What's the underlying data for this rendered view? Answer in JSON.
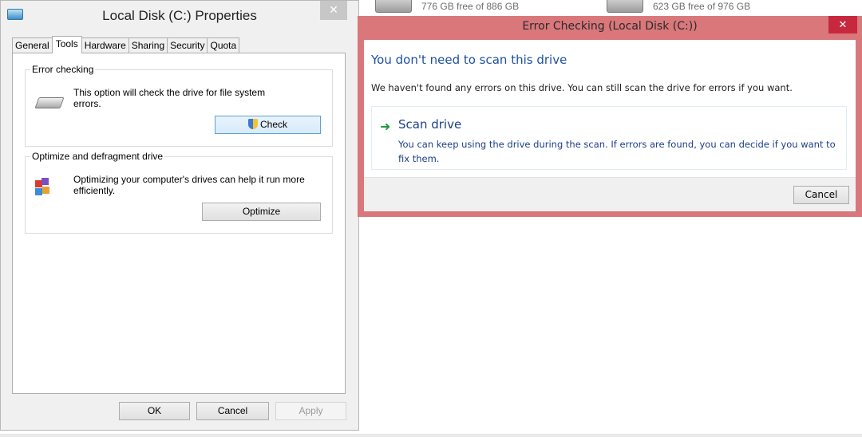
{
  "background": {
    "drive_d_free": "776 GB free of 886 GB",
    "drive_e_free": "623 GB free of 976 GB"
  },
  "properties": {
    "title": "Local Disk (C:) Properties",
    "close_glyph": "✕",
    "tabs": [
      "General",
      "Tools",
      "Hardware",
      "Sharing",
      "Security",
      "Quota"
    ],
    "active_tab": "Tools",
    "error_checking": {
      "legend": "Error checking",
      "description": "This option will check the drive for file system errors.",
      "button": "Check"
    },
    "optimize": {
      "legend": "Optimize and defragment drive",
      "description": "Optimizing your computer's drives can help it run more efficiently.",
      "button": "Optimize"
    },
    "buttons": {
      "ok": "OK",
      "cancel": "Cancel",
      "apply": "Apply"
    }
  },
  "error_dialog": {
    "title": "Error Checking (Local Disk (C:))",
    "close_glyph": "✕",
    "heading": "You don't need to scan this drive",
    "info": "We haven't found any errors on this drive. You can still scan the drive for errors if you want.",
    "scan_title": "Scan drive",
    "scan_description": "You can keep using the drive during the scan. If errors are found, you can decide if you want to fix them.",
    "cancel": "Cancel",
    "accent_color": "#d9777b"
  }
}
